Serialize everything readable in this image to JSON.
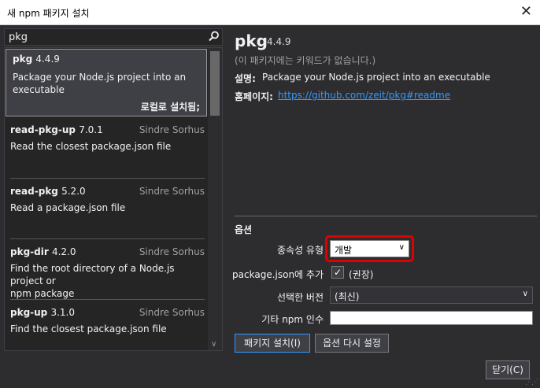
{
  "window": {
    "title": "새 npm 패키지 설치",
    "close_glyph": "✕"
  },
  "search": {
    "query": "pkg",
    "icon": "search-icon"
  },
  "packages": [
    {
      "name": "pkg",
      "version": "4.4.9",
      "author": "",
      "description": "Package your Node.js project into an executable",
      "status": "로컬로 설치됨;",
      "selected": true
    },
    {
      "name": "read-pkg-up",
      "version": "7.0.1",
      "author": "Sindre Sorhus",
      "description": "Read the closest package.json file"
    },
    {
      "name": "read-pkg",
      "version": "5.2.0",
      "author": "Sindre Sorhus",
      "description": "Read a package.json file"
    },
    {
      "name": "pkg-dir",
      "version": "4.2.0",
      "author": "Sindre Sorhus",
      "description_line1": "Find the root directory of a Node.js project or",
      "description_line2": "npm package"
    },
    {
      "name": "pkg-up",
      "version": "3.1.0",
      "author": "Sindre Sorhus",
      "description": "Find the closest package.json file"
    }
  ],
  "details": {
    "name": "pkg",
    "version": "4.4.9",
    "no_keywords": "(이 패키지에는 키워드가 없습니다.)",
    "description_label": "설명:",
    "description": "Package your Node.js project into an executable",
    "homepage_label": "홈페이지:",
    "homepage": "https://github.com/zeit/pkg#readme"
  },
  "options": {
    "title": "옵션",
    "dependency_type_label": "종속성 유형",
    "dependency_type_value": "개발",
    "add_to_package_json_label": "package.json에 추가",
    "add_to_package_json_checked": true,
    "recommended": "(권장)",
    "version_label": "선택한 버전",
    "version_value": "(최신)",
    "other_args_label": "기타 npm 인수",
    "other_args_value": ""
  },
  "buttons": {
    "install": "패키지 설치(I)",
    "reset": "옵션 다시 설정",
    "close": "닫기(C)"
  },
  "colors": {
    "background": "#2d2d30",
    "link": "#3399ff",
    "highlight": "#e00000"
  }
}
